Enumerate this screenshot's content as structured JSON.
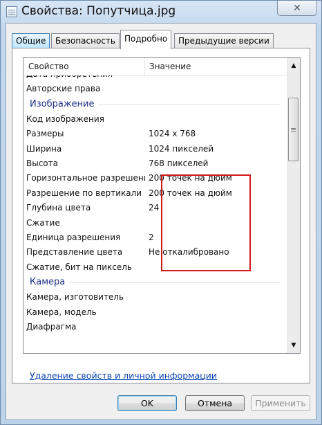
{
  "window": {
    "title": "Свойства: Попутчица.jpg"
  },
  "tabs": [
    {
      "label": "Общие"
    },
    {
      "label": "Безопасность"
    },
    {
      "label": "Подробно"
    },
    {
      "label": "Предыдущие версии"
    }
  ],
  "list": {
    "col_property": "Свойство",
    "col_value": "Значение",
    "rows": [
      {
        "type": "row",
        "prop": "Дата приобретения",
        "value": ""
      },
      {
        "type": "row",
        "prop": "Авторские права",
        "value": ""
      },
      {
        "type": "group",
        "prop": "Изображение"
      },
      {
        "type": "row",
        "prop": "Код изображения",
        "value": ""
      },
      {
        "type": "row",
        "prop": "Размеры",
        "value": "1024 x 768"
      },
      {
        "type": "row",
        "prop": "Ширина",
        "value": "1024 пикселей"
      },
      {
        "type": "row",
        "prop": "Высота",
        "value": "768 пикселей"
      },
      {
        "type": "row",
        "prop": "Горизонтальное разрешение",
        "value": "200 точек на дюйм"
      },
      {
        "type": "row",
        "prop": "Разрешение по вертикали",
        "value": "200 точек на дюйм"
      },
      {
        "type": "row",
        "prop": "Глубина цвета",
        "value": "24"
      },
      {
        "type": "row",
        "prop": "Сжатие",
        "value": ""
      },
      {
        "type": "row",
        "prop": "Единица разрешения",
        "value": "2"
      },
      {
        "type": "row",
        "prop": "Представление цвета",
        "value": "Не откалибровано"
      },
      {
        "type": "row",
        "prop": "Сжатие, бит на пиксель",
        "value": ""
      },
      {
        "type": "group",
        "prop": "Камера"
      },
      {
        "type": "row",
        "prop": "Камера, изготовитель",
        "value": ""
      },
      {
        "type": "row",
        "prop": "Камера, модель",
        "value": ""
      },
      {
        "type": "row",
        "prop": "Диафрагма",
        "value": ""
      }
    ]
  },
  "link": {
    "label": "Удаление свойств и личной информации"
  },
  "buttons": {
    "ok": "OK",
    "cancel": "Отмена",
    "apply": "Применить"
  },
  "icons": {
    "close": "close-icon",
    "app": "document-icon",
    "scroll_up": "arrow-up-icon",
    "scroll_down": "arrow-down-icon"
  },
  "colors": {
    "highlight_box": "#d21a1a",
    "group_header": "#1e3287",
    "link": "#0a44b3"
  }
}
